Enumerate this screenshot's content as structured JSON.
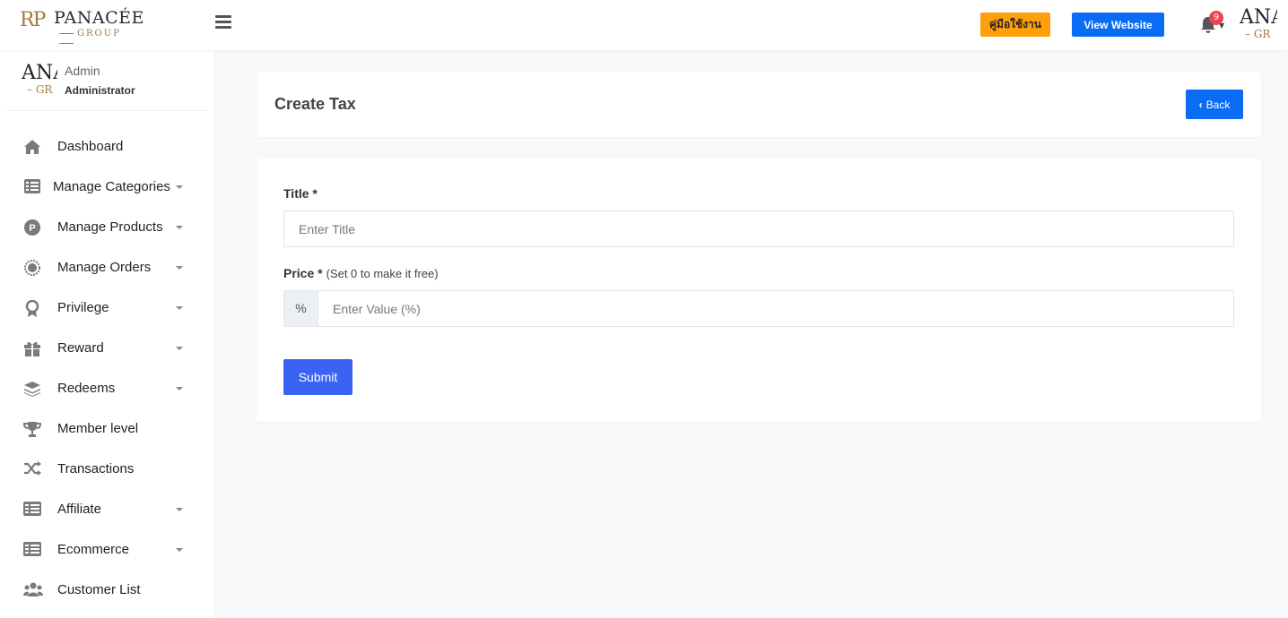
{
  "header": {
    "logo_mark": "RP",
    "logo_brand": "PANACÉE",
    "logo_group": "GROUP",
    "manual_label": "คู่มือใช้งาน",
    "view_website_label": "View Website",
    "notification_count": "9",
    "avatar_text_big": "ANA",
    "avatar_text_small": "– GR",
    "colors": {
      "manual": "#ff9f0a",
      "view_website": "#0a6cf5",
      "badge": "#ea4352"
    }
  },
  "sidebar": {
    "profile": {
      "name": "Admin",
      "role": "Administrator",
      "avatar_big": "ANA",
      "avatar_small": "– GR"
    },
    "items": [
      {
        "label": "Dashboard",
        "icon": "home-icon",
        "caret": false
      },
      {
        "label": "Manage Categories",
        "icon": "list-icon",
        "caret": true
      },
      {
        "label": "Manage Products",
        "icon": "product-p-icon",
        "caret": true
      },
      {
        "label": "Manage Orders",
        "icon": "order-badge-icon",
        "caret": true
      },
      {
        "label": "Privilege",
        "icon": "award-icon",
        "caret": true
      },
      {
        "label": "Reward",
        "icon": "gift-icon",
        "caret": true
      },
      {
        "label": "Redeems",
        "icon": "layers-icon",
        "caret": true
      },
      {
        "label": "Member level",
        "icon": "trophy-icon",
        "caret": false
      },
      {
        "label": "Transactions",
        "icon": "shuffle-icon",
        "caret": false
      },
      {
        "label": "Affiliate",
        "icon": "affiliate-list-icon",
        "caret": true
      },
      {
        "label": "Ecommerce",
        "icon": "ecommerce-list-icon",
        "caret": true
      },
      {
        "label": "Customer List",
        "icon": "users-icon",
        "caret": false
      }
    ]
  },
  "main": {
    "page_title": "Create Tax",
    "back_label": "Back",
    "form": {
      "title_label": "Title *",
      "title_placeholder": "Enter Title",
      "title_value": "",
      "price_label": "Price *",
      "price_hint": "(Set 0 to make it free)",
      "price_addon": "%",
      "price_placeholder": "Enter Value (%)",
      "price_value": "",
      "submit_label": "Submit"
    }
  }
}
